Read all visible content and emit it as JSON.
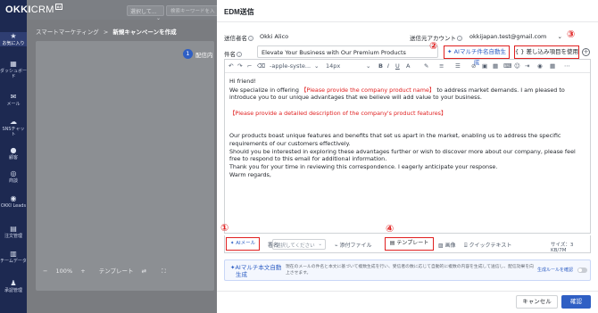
{
  "app": {
    "logo_main": "OKKI",
    "logo_sub": "CRM",
    "logo_badge": "AI"
  },
  "nav": [
    {
      "label": "お気に入り",
      "icon": "star-icon"
    },
    {
      "label": "ダッシュボード",
      "icon": "dashboard-icon"
    },
    {
      "label": "メール",
      "icon": "mail-icon"
    },
    {
      "label": "SNSチャット",
      "icon": "chat-icon"
    },
    {
      "label": "顧客",
      "icon": "customer-icon"
    },
    {
      "label": "商談",
      "icon": "deal-icon"
    },
    {
      "label": "OKKI Leads",
      "icon": "leads-icon"
    },
    {
      "label": "注文管理",
      "icon": "order-icon"
    },
    {
      "label": "チームデータ",
      "icon": "team-data-icon"
    },
    {
      "label": "承認管理",
      "icon": "approval-icon"
    }
  ],
  "background": {
    "select_placeholder": "選択して...",
    "search_placeholder": "検索キーワードを入",
    "breadcrumb_parent": "スマートマーケティング",
    "breadcrumb_sep": ">",
    "breadcrumb_current": "新規キャンペーンを作成",
    "step_number": "1",
    "step_label": "配信内",
    "zoom_minus": "−",
    "zoom_value": "100%",
    "zoom_plus": "+",
    "template_label": "テンプレート"
  },
  "drawer": {
    "title": "EDM送信",
    "sender_name_label": "送信者名",
    "sender_name_value": "Okki Alico",
    "sender_account_label": "送信元アカウント",
    "sender_account_value": "okkijapan.test@gmail.com",
    "subject_label": "件名",
    "subject_value": "Elevate Your Business with Our Premium Products",
    "ai_subject_button": "AIマルチ件名自動生成",
    "insert_fields_button": "差し込み項目を使用",
    "annotations": [
      "①",
      "②",
      "③",
      "④"
    ]
  },
  "toolbar": {
    "font_family": "-apple-syste...",
    "font_size": "14px"
  },
  "email_body": {
    "greeting": "Hi friend!",
    "p1_before": "We specialize in offering ",
    "p1_placeholder": "【Please provide the company product name】",
    "p1_after": " to address market demands. I am pleased to introduce you to our unique advantages that we believe will add value to your business.",
    "p2_placeholder": "【Please provide a detailed description of the company's product features】",
    "p3": "Our products boast unique features and benefits that set us apart in the market, enabling us to address the specific requirements of our customers effectively.",
    "p4": "Should you be interested in exploring these advantages further or wish to discover more about our company, please feel free to respond to this email for additional information.",
    "p5": "Thank you for your time in reviewing this correspondence. I eagerly anticipate your response.",
    "closing": "Warm regards,"
  },
  "bottom_bar": {
    "ai_mail": "AIメール",
    "signature_label": "署名",
    "signature_placeholder": "選択してください",
    "attachment": "添付ファイル",
    "template": "テンプレート",
    "image": "画像",
    "quick_text": "クイックテキスト",
    "size": "サイズ：3 KB/7M"
  },
  "ai_banner": {
    "title_line1": "AIマルチ本文自動",
    "title_line2": "生成",
    "description": "現在のメールの件名と本文に基づいて複数生成を行い、受信者の数に応じて自動的に複数の内容を生成して送信し、配信効果を向上させます。",
    "rules_link": "生成ルールを確認"
  },
  "footer": {
    "cancel": "キャンセル",
    "confirm": "確認"
  },
  "colors": {
    "nav_bg": "#1d2951",
    "primary": "#2f5fc4",
    "annotation_red": "#e02020",
    "placeholder_red": "#e02020"
  }
}
